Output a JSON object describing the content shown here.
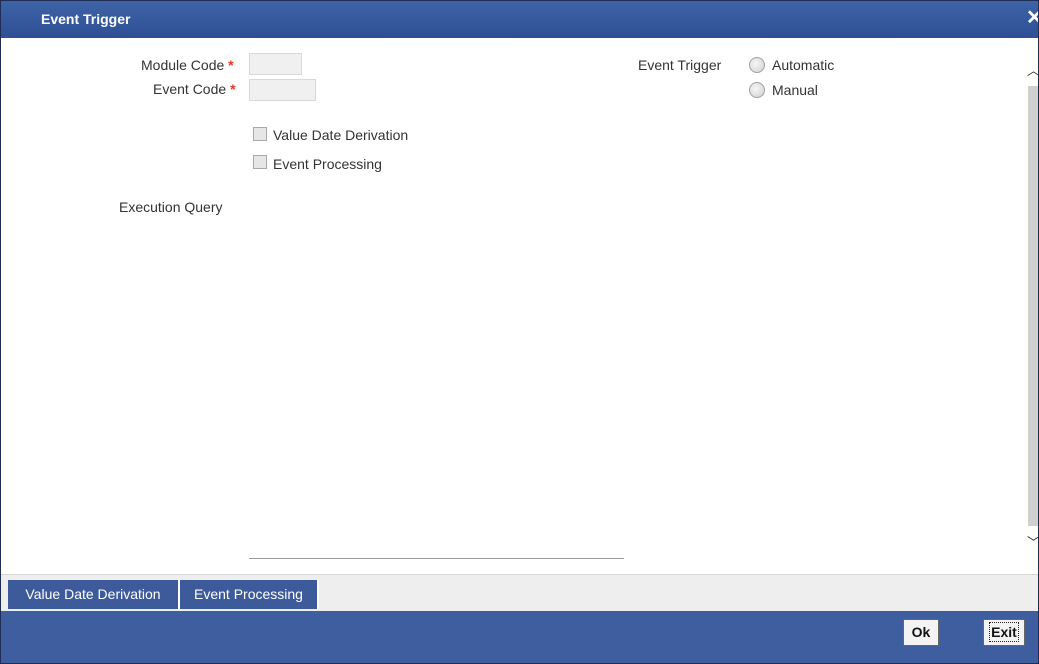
{
  "window": {
    "title": "Event Trigger",
    "close_icon": "close-icon"
  },
  "form": {
    "module_code": {
      "label": "Module Code",
      "value": ""
    },
    "event_code": {
      "label": "Event Code",
      "value": ""
    },
    "required_mark": "*",
    "value_date_derivation": {
      "label": "Value Date Derivation",
      "checked": false
    },
    "event_processing": {
      "label": "Event Processing",
      "checked": false
    },
    "execution_query": {
      "label": "Execution Query",
      "value": ""
    },
    "event_trigger": {
      "label": "Event Trigger",
      "options": [
        "Automatic",
        "Manual"
      ],
      "selected": null
    }
  },
  "scrollbar": {
    "up_icon": "chevron-up-icon",
    "down_icon": "chevron-down-icon"
  },
  "tabs": [
    {
      "label": "Value Date Derivation"
    },
    {
      "label": "Event Processing"
    }
  ],
  "footer": {
    "ok_label": "Ok",
    "exit_label": "Exit"
  },
  "colors": {
    "title_bar": "#2e4f93",
    "footer": "#3f5e9f",
    "tab": "#3d5a9b",
    "required": "#e32222"
  }
}
